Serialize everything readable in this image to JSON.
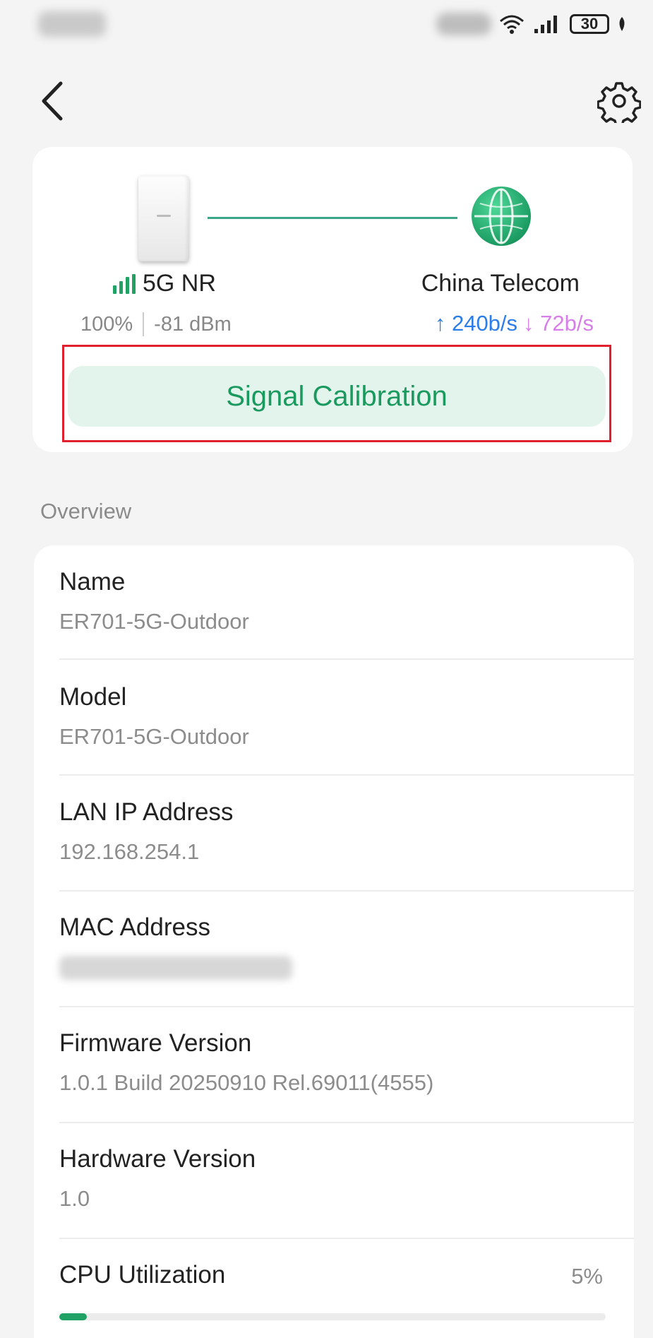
{
  "status_bar": {
    "battery": "30"
  },
  "device": {
    "network_type": "5G NR",
    "signal_strength": "100%",
    "signal_power": "-81 dBm",
    "isp": "China Telecom",
    "upload_rate": "↑ 240b/s",
    "download_rate": "↓ 72b/s",
    "calibration_label": "Signal Calibration"
  },
  "overview": {
    "title": "Overview",
    "rows": [
      {
        "label": "Name",
        "value": "ER701-5G-Outdoor"
      },
      {
        "label": "Model",
        "value": "ER701-5G-Outdoor"
      },
      {
        "label": "LAN IP Address",
        "value": "192.168.254.1"
      },
      {
        "label": "MAC Address",
        "value": ""
      },
      {
        "label": "Firmware Version",
        "value": "1.0.1 Build 20250910 Rel.69011(4555)"
      },
      {
        "label": "Hardware Version",
        "value": "1.0"
      }
    ],
    "cpu": {
      "label": "CPU Utilization",
      "value": "5%",
      "fraction": 0.05
    }
  },
  "colors": {
    "accent": "#1a9a5e",
    "upload": "#2b7de9",
    "download": "#d77fe8",
    "highlight": "#e0202e"
  }
}
